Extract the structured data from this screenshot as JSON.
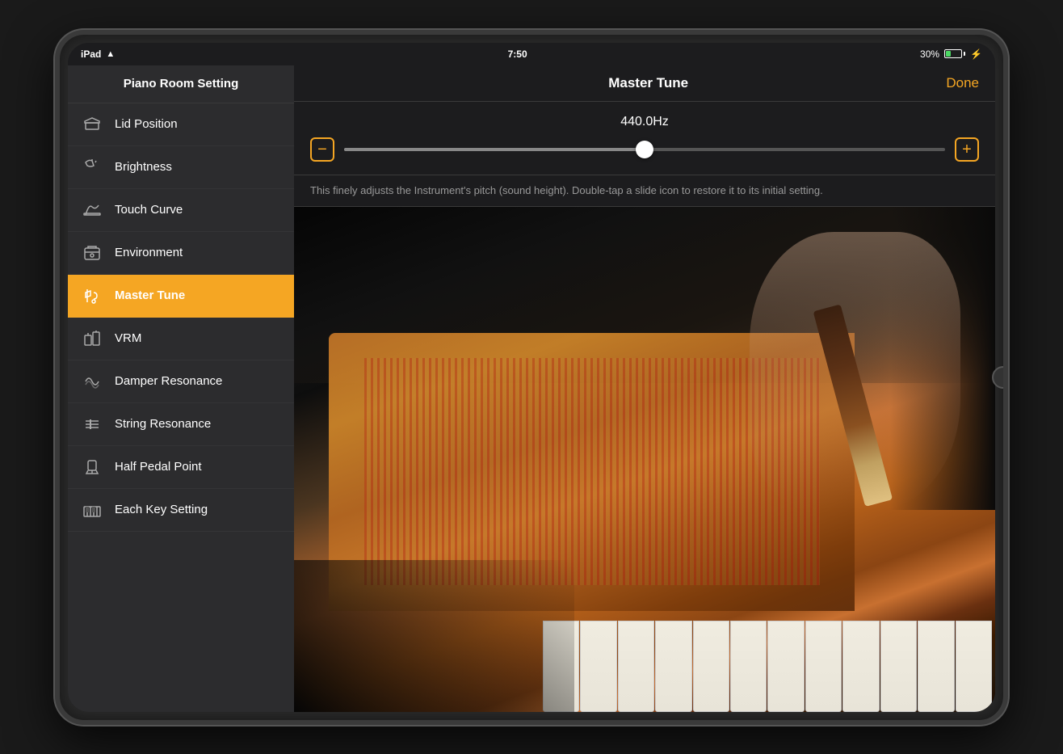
{
  "device": {
    "status_bar": {
      "left": "iPad",
      "center": "7:50",
      "right_battery": "30%"
    }
  },
  "sidebar": {
    "header_title": "Piano Room Setting",
    "items": [
      {
        "id": "lid-position",
        "label": "Lid Position",
        "icon": "lid"
      },
      {
        "id": "brightness",
        "label": "Brightness",
        "icon": "brightness"
      },
      {
        "id": "touch-curve",
        "label": "Touch Curve",
        "icon": "touch"
      },
      {
        "id": "environment",
        "label": "Environment",
        "icon": "environment"
      },
      {
        "id": "master-tune",
        "label": "Master Tune",
        "icon": "tune",
        "active": true
      },
      {
        "id": "vrm",
        "label": "VRM",
        "icon": "vrm"
      },
      {
        "id": "damper-resonance",
        "label": "Damper Resonance",
        "icon": "damper"
      },
      {
        "id": "string-resonance",
        "label": "String Resonance",
        "icon": "string"
      },
      {
        "id": "half-pedal-point",
        "label": "Half Pedal Point",
        "icon": "pedal"
      },
      {
        "id": "each-key-setting",
        "label": "Each Key Setting",
        "icon": "key"
      }
    ]
  },
  "main": {
    "title": "Master Tune",
    "done_label": "Done",
    "tune_value": "440.0Hz",
    "slider_value": 50,
    "description": "This finely adjusts the Instrument's pitch (sound height). Double-tap a slide icon to restore it to its initial setting.",
    "minus_label": "−",
    "plus_label": "+"
  }
}
